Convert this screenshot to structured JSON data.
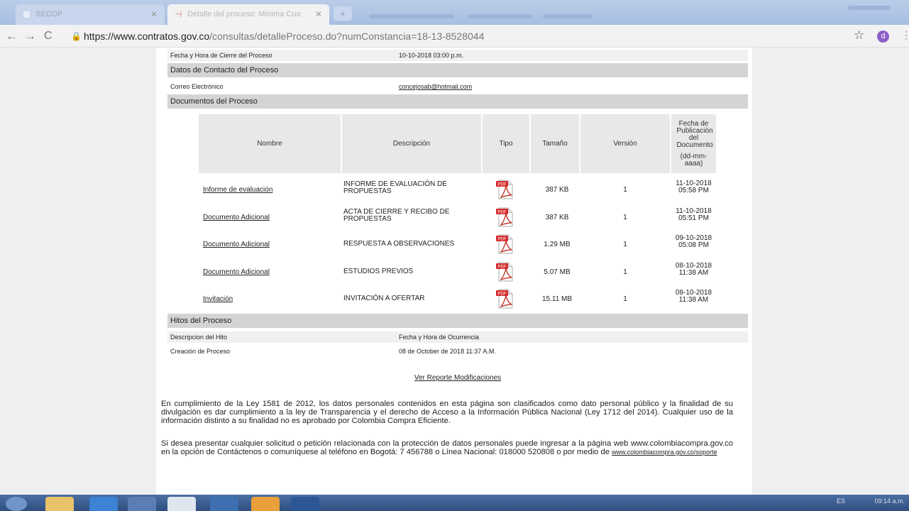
{
  "browser": {
    "tab_inactive": "SECOP",
    "tab_active": "Detalle del proceso: Mínima Cua",
    "new_tab_symbol": "+",
    "close_symbol": "✕",
    "url_host": "https://www.contratos.gov.co",
    "url_path": "/consultas/detalleProceso.do?numConstancia=18-13-8528044",
    "profile_initial": "d"
  },
  "process": {
    "closing_label": "Fecha y Hora de Cierre del Proceso",
    "closing_value": "10-10-2018 03:00 p.m.",
    "contact_section": "Datos de Contacto del Proceso",
    "email_label": "Correo Electrónico",
    "email_value": "concejosab@hotmail.com",
    "documents_section": "Documentos del Proceso"
  },
  "documents": {
    "headers": {
      "nombre": "Nombre",
      "descripcion": "Descripción",
      "tipo": "Tipo",
      "tamano": "Tamaño",
      "version": "Versión",
      "fecha": "Fecha de Publicación del Documento",
      "fecha_format": "(dd-mm-aaaa)"
    },
    "rows": [
      {
        "name": "Informe de evaluación",
        "desc": "INFORME DE EVALUACIÓN DE PROPUESTAS",
        "size": "387 KB",
        "version": "1",
        "date": "11-10-2018",
        "time": "05:58 PM"
      },
      {
        "name": "Documento Adicional",
        "desc": "ACTA DE CIERRE Y RECIBO DE PROPUESTAS",
        "size": "387 KB",
        "version": "1",
        "date": "11-10-2018",
        "time": "05:51 PM"
      },
      {
        "name": "Documento Adicional",
        "desc": "RESPUESTA A OBSERVACIONES",
        "size": "1.29 MB",
        "version": "1",
        "date": "09-10-2018",
        "time": "05:08 PM"
      },
      {
        "name": "Documento Adicional",
        "desc": "ESTUDIOS PREVIOS",
        "size": "5.07 MB",
        "version": "1",
        "date": "08-10-2018",
        "time": "11:38 AM"
      },
      {
        "name": "Invitación",
        "desc": "INVITACIÓN A OFERTAR",
        "size": "15.11 MB",
        "version": "1",
        "date": "08-10-2018",
        "time": "11:38 AM"
      }
    ],
    "pdf_badge": "PDF"
  },
  "milestones": {
    "section": "Hitos del Proceso",
    "col1": "Descripcion del Hito",
    "col2": "Fecha y Hora de Ocurrencia",
    "row_desc": "Creación de Proceso",
    "row_date": "08 de October de 2018 11:37 A.M."
  },
  "report_link": "Ver Reporte Modificaciones",
  "legal": {
    "p1": "En cumplimiento de la Ley 1581 de 2012, los datos personales contenidos en esta página son clasificados como dato personal público y la finalidad de su divulgación es dar cumplimiento a la ley de Transparencia y el derecho de Acceso a la Información Pública Nacional (Ley 1712 del 2014). Cualquier uso de la información distinto a su finalidad no es aprobado por Colombia Compra Eficiente.",
    "p2": "Si desea presentar cualquier solicitud o petición relacionada con la protección de datos personales puede ingresar a la página web www.colombiacompra.gov.co en la opción de Contáctenos o comuníquese al teléfono en Bogotá: 7 456788 o Línea Nacional: 018000 520808 o por medio de ",
    "p2_link": "www.colombiacompra.gov.co/soporte"
  },
  "taskbar": {
    "time": "09:14 a.m.",
    "lang": "ES"
  }
}
